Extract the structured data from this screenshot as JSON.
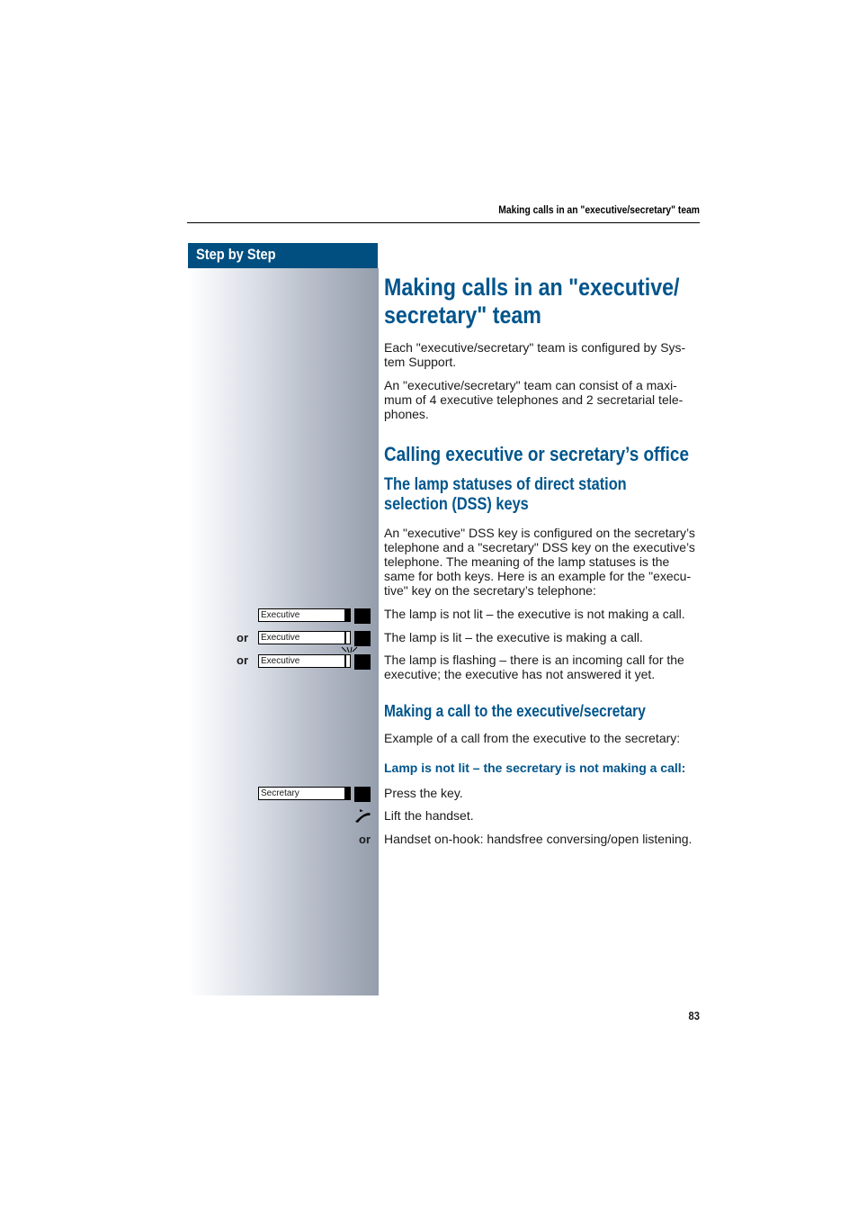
{
  "running_header": "Making calls in an \"executive/secretary\" team",
  "sidebar": {
    "title": "Step by Step"
  },
  "title": "Making calls in an \"executive/ secretary\" team",
  "title_lines": [
    "Making calls in an \"executive/",
    "secretary\" team"
  ],
  "intro": [
    "Each \"executive/secretary\" team is configured by Sys-tem Support.",
    "An \"executive/secretary\" team can consist of a maxi-mum of 4 executive telephones and 2 secretarial tele-phones."
  ],
  "section": {
    "heading": "Calling executive or secretary’s office"
  },
  "lamp_section": {
    "heading": "The lamp statuses of direct station selection (DSS) keys",
    "body": "An \"executive\" DSS key is configured on the secretary’s telephone and a \"secretary\" DSS key on the executive’s telephone. The meaning of the lamp statuses is the same for both keys. Here is an example for the \"execu-tive\" key on the secretary’s telephone:",
    "states": [
      {
        "key_label": "Executive",
        "lamp": "off",
        "prefix": "",
        "text": "The lamp is not lit – the executive is not making a call."
      },
      {
        "key_label": "Executive",
        "lamp": "on",
        "prefix": "or",
        "text": "The lamp is lit – the executive is making a call."
      },
      {
        "key_label": "Executive",
        "lamp": "flashing",
        "prefix": "or",
        "text": "The lamp is flashing – there is an incoming call for the executive; the executive has not answered it yet."
      }
    ]
  },
  "call_section": {
    "heading": "Making a call to the executive/secretary",
    "intro": "Example of a call from the executive to the secretary:",
    "subheading": "Lamp is not lit – the secretary is not making a call:",
    "steps": [
      {
        "key_label": "Secretary",
        "icon": "dss-key",
        "prefix": "",
        "text": "Press the key."
      },
      {
        "icon": "lift-handset-icon",
        "prefix": "",
        "text": "Lift the handset."
      },
      {
        "icon": "",
        "prefix": "or",
        "text": "Handset on-hook: handsfree conversing/open listening."
      }
    ]
  },
  "page_number": "83"
}
